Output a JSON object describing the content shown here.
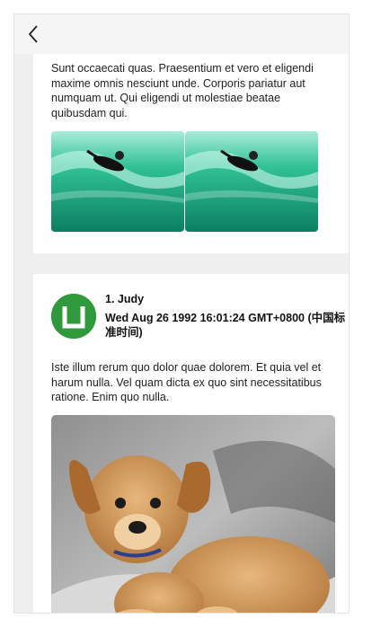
{
  "header": {
    "back_icon": "chevron-left-icon"
  },
  "posts": [
    {
      "text": "Sunt occaecati quas. Praesentium et vero et eligendi maxime omnis nesciunt unde. Corporis pariatur aut numquam ut. Qui eligendi ut molestiae beatae quibusdam qui.",
      "images": [
        "surfer-photo",
        "surfer-photo"
      ]
    },
    {
      "author": "1. Judy",
      "date": "Wed Aug 26 1992 16:01:24 GMT+0800 (中国标准时间)",
      "text": "Iste illum rerum quo dolor quae dolorem. Et quia vel et harum nulla. Vel quam dicta ex quo sint necessitatibus ratione. Enim quo nulla.",
      "avatar_color": "#2f9a3b",
      "images": [
        "dog-photo"
      ]
    }
  ]
}
